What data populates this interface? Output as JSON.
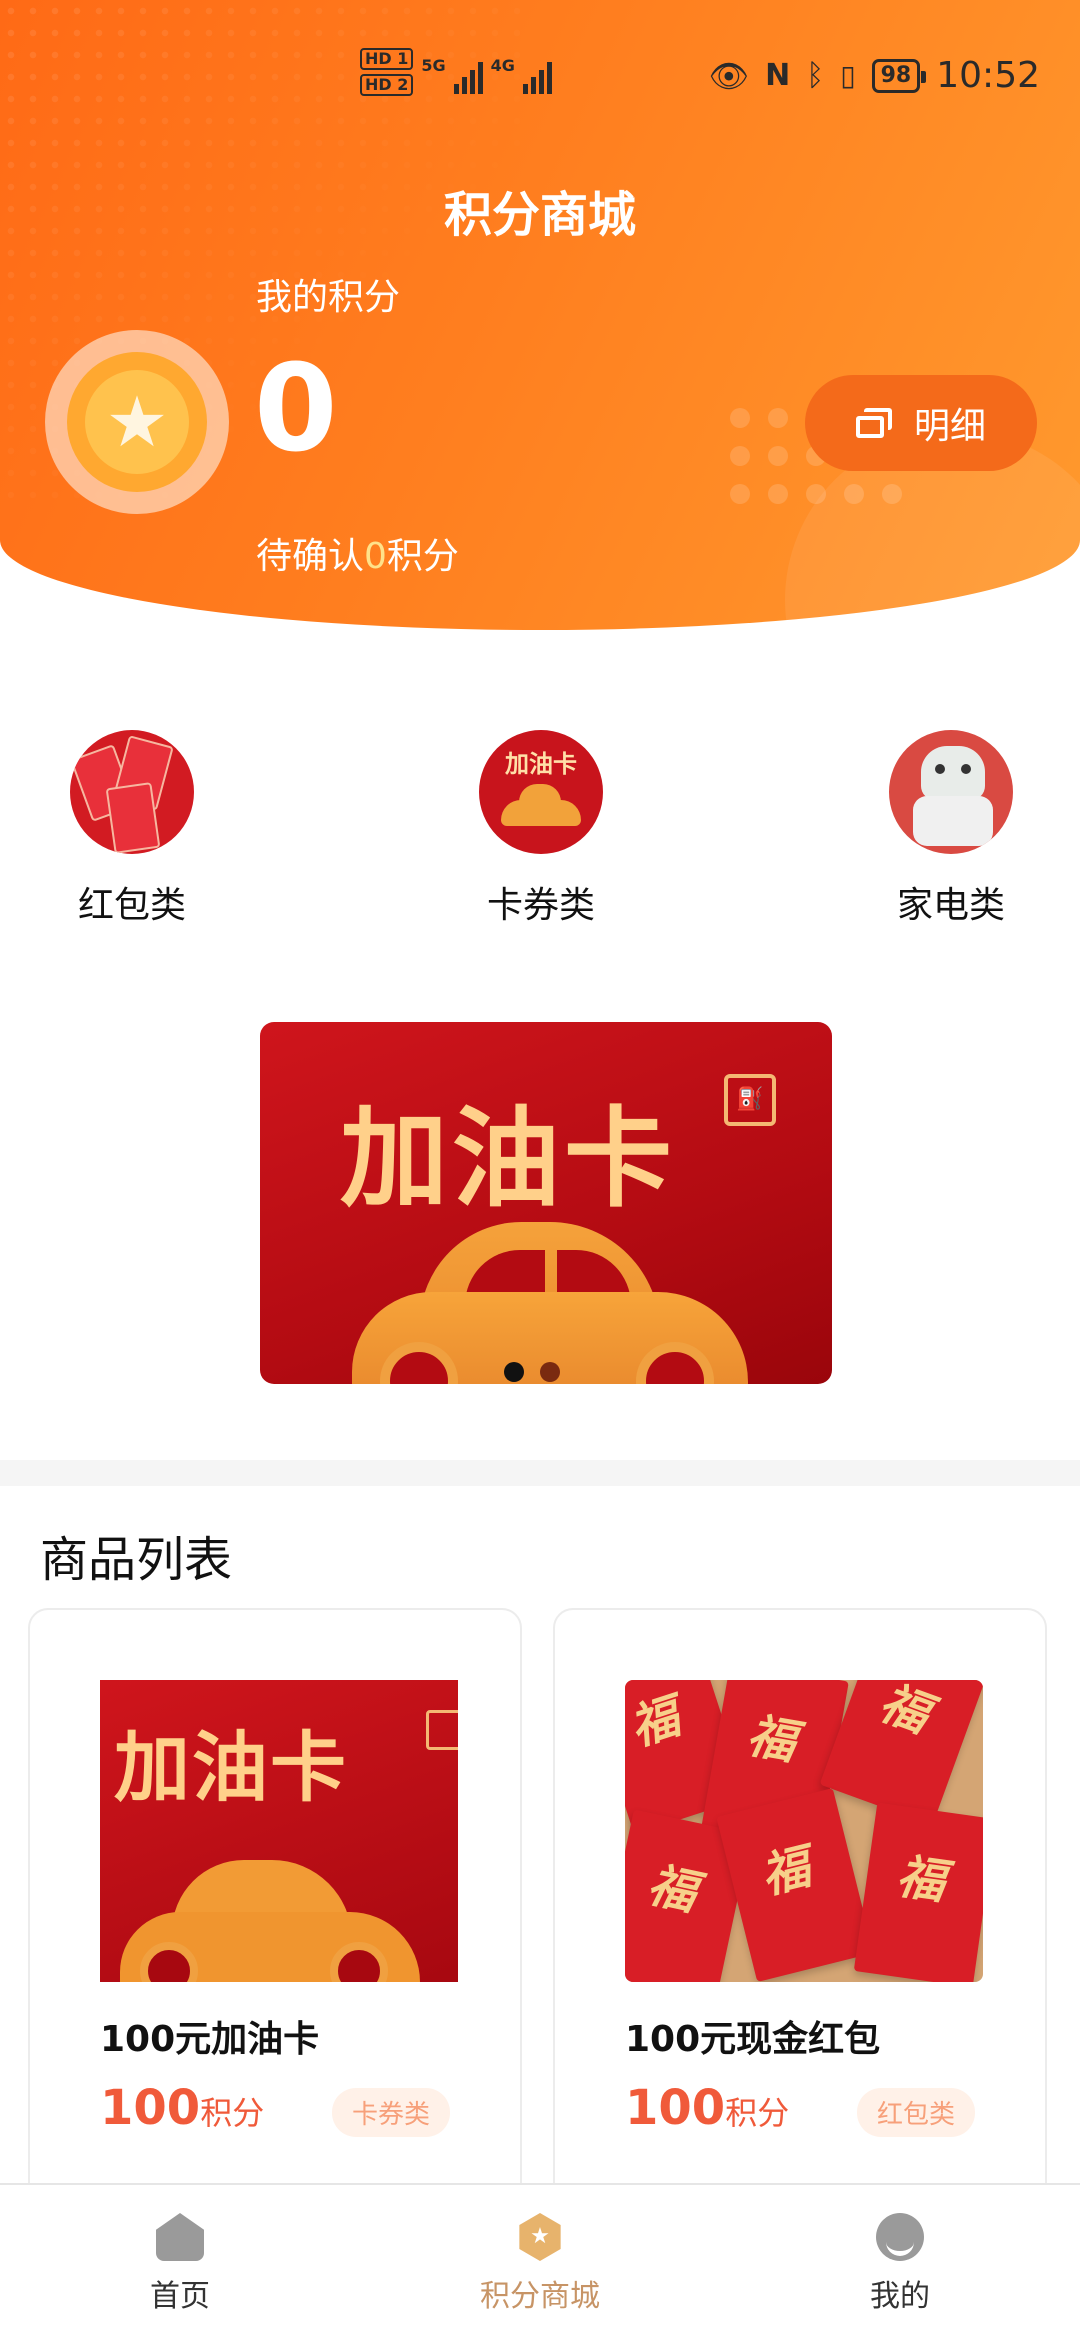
{
  "status_bar": {
    "hd1": "HD",
    "hd1_index": "1",
    "hd2": "HD",
    "hd2_index": "2",
    "net1": "5G",
    "net2": "4G",
    "battery": "98",
    "time": "10:52"
  },
  "header": {
    "title": "积分商城",
    "points_label": "我的积分",
    "points_value": "0",
    "pending_prefix": "待确认",
    "pending_value": "0",
    "pending_suffix": "积分",
    "detail_button": "明细"
  },
  "categories": [
    {
      "label": "红包类",
      "icon": "red-envelope-thumb"
    },
    {
      "label": "卡券类",
      "icon": "fuel-card-thumb",
      "thumb_text": "加油卡"
    },
    {
      "label": "家电类",
      "icon": "appliance-thumb"
    }
  ],
  "banner": {
    "title": "加油卡",
    "slides": 2,
    "active_slide": 1
  },
  "product_list": {
    "title": "商品列表",
    "items": [
      {
        "name": "100元加油卡",
        "price": "100",
        "unit": "积分",
        "tag": "卡券类",
        "image_text": "加油卡"
      },
      {
        "name": "100元现金红包",
        "price": "100",
        "unit": "积分",
        "tag": "红包类",
        "image_text": "福"
      }
    ]
  },
  "bottom_nav": {
    "items": [
      {
        "label": "首页",
        "icon": "home-icon"
      },
      {
        "label": "积分商城",
        "icon": "points-mall-icon",
        "active": true
      },
      {
        "label": "我的",
        "icon": "profile-icon"
      }
    ]
  },
  "colors": {
    "header_gradient_start": "#ff6a16",
    "header_gradient_end": "#ff9a2e",
    "price": "#f05a3a",
    "active_nav": "#c79466"
  }
}
